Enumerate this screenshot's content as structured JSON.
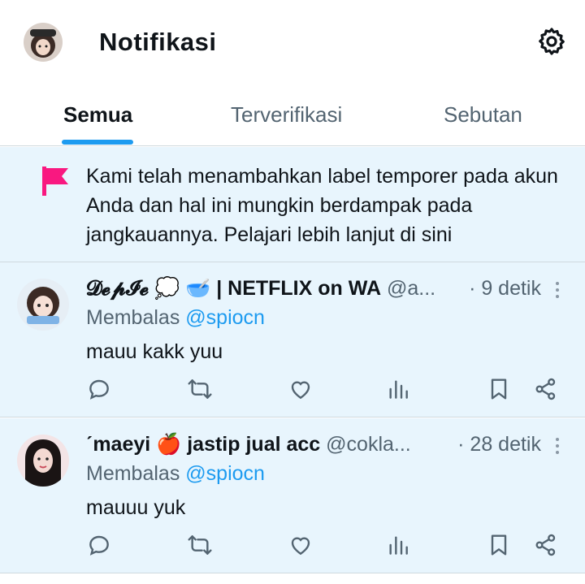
{
  "header": {
    "title": "Notifikasi",
    "avatar_icon": "user-avatar",
    "settings_icon": "gear-icon"
  },
  "tabs": [
    {
      "label": "Semua",
      "active": true
    },
    {
      "label": "Terverifikasi",
      "active": false
    },
    {
      "label": "Sebutan",
      "active": false
    }
  ],
  "notice": {
    "icon": "flag-icon",
    "text": "Kami telah menambahkan label temporer pada akun Anda dan hal ini mungkin berdampak pada jangkauannya. Pelajari lebih lanjut di sini",
    "accent": "#f91880"
  },
  "tweets": [
    {
      "name": "𝓓𝓮𝓹𝓘𝓮 💭 🥣 | NETFLIX on WA",
      "handle": "@a...",
      "time": "· 9 detik",
      "reply_prefix": "Membalas",
      "reply_to": "@spiocn",
      "text": "mauu kakk yuu"
    },
    {
      "name": "ˊmaeyi 🍎 jastip jual acc",
      "handle": "@cokla...",
      "time": "· 28 detik",
      "reply_prefix": "Membalas",
      "reply_to": "@spiocn",
      "text": "mauuu yuk"
    }
  ],
  "colors": {
    "accent": "#1d9bf0",
    "unread_bg": "#e8f5fd",
    "secondary_text": "#536471",
    "divider": "#cfd9de"
  }
}
